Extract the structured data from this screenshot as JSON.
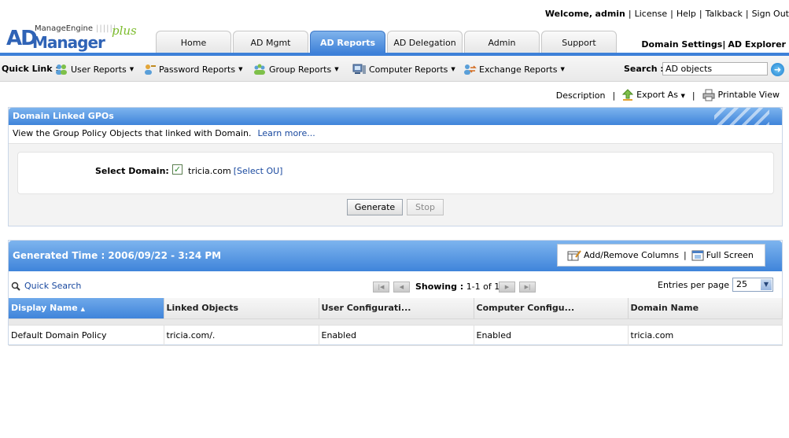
{
  "logo": {
    "vendor": "ManageEngine",
    "product_prefix": "AD",
    "product": "Manager",
    "edition": "plus"
  },
  "top_links": {
    "welcome": "Welcome,",
    "user": "admin",
    "items": [
      "License",
      "Help",
      "Talkback",
      "Sign Out"
    ]
  },
  "tabs": [
    "Home",
    "AD Mgmt",
    "AD Reports",
    "AD Delegation",
    "Admin",
    "Support"
  ],
  "active_tab": "AD Reports",
  "domain_links": {
    "settings": "Domain Settings",
    "explorer": "AD Explorer"
  },
  "quick_links": {
    "label": "Quick Link :",
    "items": [
      "User Reports",
      "Password Reports",
      "Group Reports",
      "Computer Reports",
      "Exchange Reports"
    ]
  },
  "search": {
    "label": "Search :",
    "value": "AD objects"
  },
  "actions": {
    "description": "Description",
    "export": "Export As",
    "printable": "Printable View"
  },
  "panel": {
    "title": "Domain Linked GPOs",
    "description": "View the Group Policy Objects that linked with Domain.",
    "learn_more": "Learn more...",
    "select_domain_label": "Select Domain:",
    "domain": "tricia.com",
    "select_ou": "[Select OU]",
    "generate": "Generate",
    "stop": "Stop"
  },
  "results": {
    "generated": "Generated Time : 2006/09/22 - 3:24 PM",
    "add_remove_columns": "Add/Remove Columns",
    "full_screen": "Full Screen",
    "quick_search": "Quick Search",
    "showing_label": "Showing :",
    "showing_value": "1-1 of 1",
    "entries_label": "Entries per page",
    "entries_value": "25",
    "columns": [
      "Display Name",
      "Linked Objects",
      "User Configurati...",
      "Computer Configu...",
      "Domain Name"
    ],
    "rows": [
      [
        "Default Domain Policy",
        "tricia.com/.",
        "Enabled",
        "Enabled",
        "tricia.com"
      ]
    ]
  },
  "colors": {
    "accent": "#3d80d8",
    "link": "#17479e",
    "logo_green": "#7cbc2c"
  }
}
